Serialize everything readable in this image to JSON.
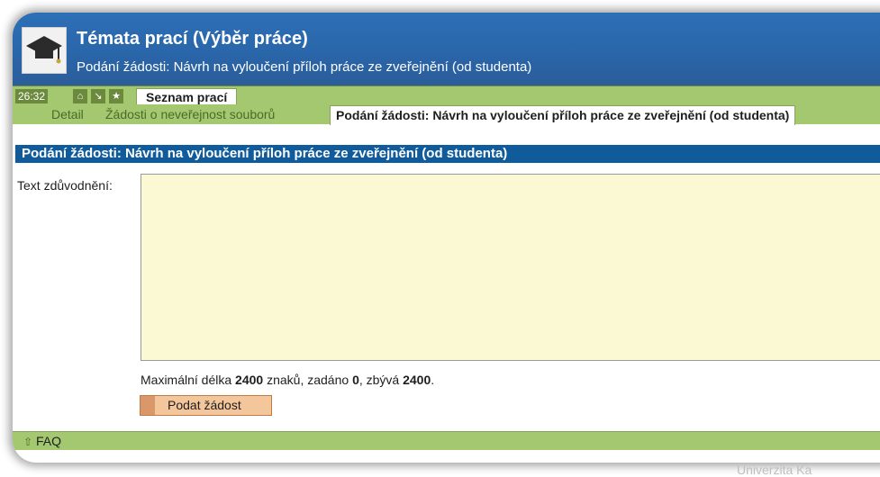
{
  "header": {
    "title": "Témata prací (Výběr práce)",
    "subtitle": "Podání žádosti: Návrh na vyloučení příloh práce ze zveřejnění (od studenta)"
  },
  "toolbar": {
    "timer": "26:32",
    "home_icon": "home-icon",
    "arrow_icon": "arrow-down-right-icon",
    "star_icon": "star-icon",
    "tab_main": "Seznam prací"
  },
  "subtabs": {
    "detail": "Detail",
    "zadosti": "Žádosti o neveřejnost souborů",
    "active": "Podání žádosti: Návrh na vyloučení příloh práce ze zveřejnění (od studenta)"
  },
  "form": {
    "section_title": "Podání žádosti: Návrh na vyloučení příloh práce ze zveřejnění (od studenta)",
    "text_label": "Text zdůvodnění:",
    "textarea_value": "",
    "limit_prefix": "Maximální délka ",
    "limit_max": "2400",
    "limit_mid": " znaků, zadáno ",
    "limit_entered": "0",
    "limit_mid2": ", zbývá ",
    "limit_remaining": "2400",
    "limit_suffix": ".",
    "submit_label": "Podat žádost"
  },
  "footer": {
    "faq": "FAQ"
  },
  "branding": {
    "university": "Univerzita Ka"
  },
  "colors": {
    "header_blue": "#2a66aa",
    "section_blue": "#0f5b9b",
    "strip_green": "#a3c86f",
    "textarea_bg": "#fbf8d4",
    "button_orange": "#f4c69b"
  }
}
